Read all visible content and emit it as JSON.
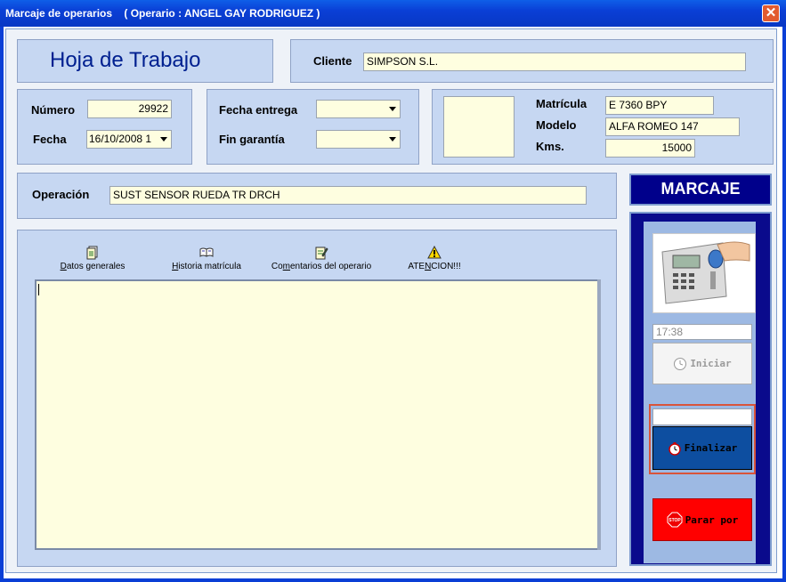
{
  "window": {
    "title": "Marcaje de operarios    ( Operario : ANGEL GAY RODRIGUEZ )"
  },
  "header": {
    "heading": "Hoja de Trabajo",
    "client_label": "Cliente",
    "client_value": "SIMPSON S.L."
  },
  "order": {
    "numero_label": "Número",
    "numero_value": "29922",
    "fecha_label": "Fecha",
    "fecha_value": "16/10/2008 1",
    "entrega_label": "Fecha entrega",
    "entrega_value": "",
    "garantia_label": "Fin garantía",
    "garantia_value": ""
  },
  "vehicle": {
    "matricula_label": "Matrícula",
    "matricula_value": "E 7360 BPY",
    "modelo_label": "Modelo",
    "modelo_value": "ALFA ROMEO 147",
    "kms_label": "Kms.",
    "kms_value": "15000"
  },
  "operation": {
    "label": "Operación",
    "value": "SUST SENSOR RUEDA TR DRCH"
  },
  "tabs": [
    {
      "pre": "",
      "ul": "D",
      "post": "atos generales",
      "icon": "document-icon"
    },
    {
      "pre": "",
      "ul": "H",
      "post": "istoria matrícula",
      "icon": "book-icon"
    },
    {
      "pre": "Co",
      "ul": "m",
      "post": "entarios del operario",
      "icon": "notepad-icon"
    },
    {
      "pre": "ATE",
      "ul": "N",
      "post": "CION!!!",
      "icon": "warning-icon"
    }
  ],
  "notes": {
    "value": ""
  },
  "marcaje": {
    "header": "MARCAJE",
    "time_value": "17:38",
    "iniciar_label": "Iniciar",
    "finalizar_value": "",
    "finalizar_label": "Finalizar",
    "parar_label": "Parar por"
  },
  "colors": {
    "title_bar": "#0a3fd6",
    "panel": "#c6d7f2",
    "input": "#fefee0",
    "marcaje_header": "#00008b",
    "finalizar": "#0d4ea0",
    "parar": "#ff0000"
  }
}
